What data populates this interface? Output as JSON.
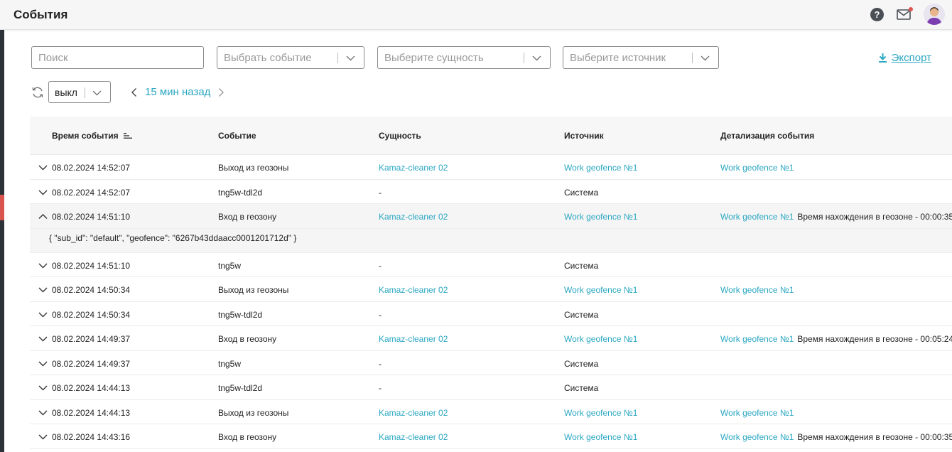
{
  "header": {
    "title": "События"
  },
  "filters": {
    "search_placeholder": "Поиск",
    "event_placeholder": "Выбрать событие",
    "entity_placeholder": "Выберите сущность",
    "source_placeholder": "Выберите источник",
    "export_label": "Экспорт"
  },
  "toolbar": {
    "refresh_value": "выкл",
    "time_label": "15 мин назад"
  },
  "table": {
    "columns": [
      "Время события",
      "Событие",
      "Сущность",
      "Источник",
      "Детализация события"
    ],
    "rows": [
      {
        "time": "08.02.2024 14:52:07",
        "event": "Выход из геозоны",
        "entity": "Kamaz-cleaner 02",
        "source": "Work geofence №1",
        "detail_link": "Work geofence №1",
        "detail_text": ""
      },
      {
        "time": "08.02.2024 14:52:07",
        "event": "tng5w-tdl2d",
        "entity": "-",
        "source": "Система",
        "detail_link": "",
        "detail_text": ""
      },
      {
        "time": "08.02.2024 14:51:10",
        "event": "Вход в геозону",
        "entity": "Kamaz-cleaner 02",
        "source": "Work geofence №1",
        "detail_link": "Work geofence №1",
        "detail_text": "Время нахождения в геозоне - 00:00:35"
      },
      {
        "time": "08.02.2024 14:51:10",
        "event": "tng5w",
        "entity": "-",
        "source": "Система",
        "detail_link": "",
        "detail_text": ""
      },
      {
        "time": "08.02.2024 14:50:34",
        "event": "Выход из геозоны",
        "entity": "Kamaz-cleaner 02",
        "source": "Work geofence №1",
        "detail_link": "Work geofence №1",
        "detail_text": ""
      },
      {
        "time": "08.02.2024 14:50:34",
        "event": "tng5w-tdl2d",
        "entity": "-",
        "source": "Система",
        "detail_link": "",
        "detail_text": ""
      },
      {
        "time": "08.02.2024 14:49:37",
        "event": "Вход в геозону",
        "entity": "Kamaz-cleaner 02",
        "source": "Work geofence №1",
        "detail_link": "Work geofence №1",
        "detail_text": "Время нахождения в геозоне - 00:05:24"
      },
      {
        "time": "08.02.2024 14:49:37",
        "event": "tng5w",
        "entity": "-",
        "source": "Система",
        "detail_link": "",
        "detail_text": ""
      },
      {
        "time": "08.02.2024 14:44:13",
        "event": "tng5w-tdl2d",
        "entity": "-",
        "source": "Система",
        "detail_link": "",
        "detail_text": ""
      },
      {
        "time": "08.02.2024 14:44:13",
        "event": "Выход из геозоны",
        "entity": "Kamaz-cleaner 02",
        "source": "Work geofence №1",
        "detail_link": "Work geofence №1",
        "detail_text": ""
      },
      {
        "time": "08.02.2024 14:43:16",
        "event": "Вход в геозону",
        "entity": "Kamaz-cleaner 02",
        "source": "Work geofence №1",
        "detail_link": "Work geofence №1",
        "detail_text": "Время нахождения в геозоне - 00:00:35"
      }
    ],
    "expanded_detail": "{ \"sub_id\": \"default\", \"geofence\": \"6267b43ddaacc0001201712d\" }"
  },
  "colors": {
    "accent": "#2aa7c2",
    "rail": "#2d3238",
    "rail_active": "#d9534f"
  }
}
